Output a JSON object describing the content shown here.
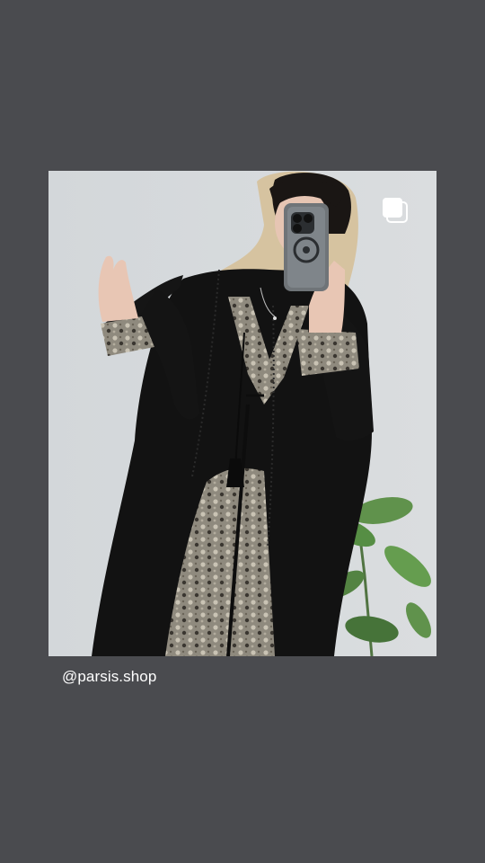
{
  "post": {
    "username": "@parsis.shop",
    "carousel_icon": "multiple-images-icon",
    "photo_subject": "woman-in-black-embroidered-manteau-mirror-selfie"
  },
  "colors": {
    "background": "#4a4b4f",
    "photo_backdrop": "#d4d8db",
    "garment": "#121212",
    "embroidery": "#9a9486",
    "scarf": "#d6c3a0",
    "text": "#ffffff"
  }
}
